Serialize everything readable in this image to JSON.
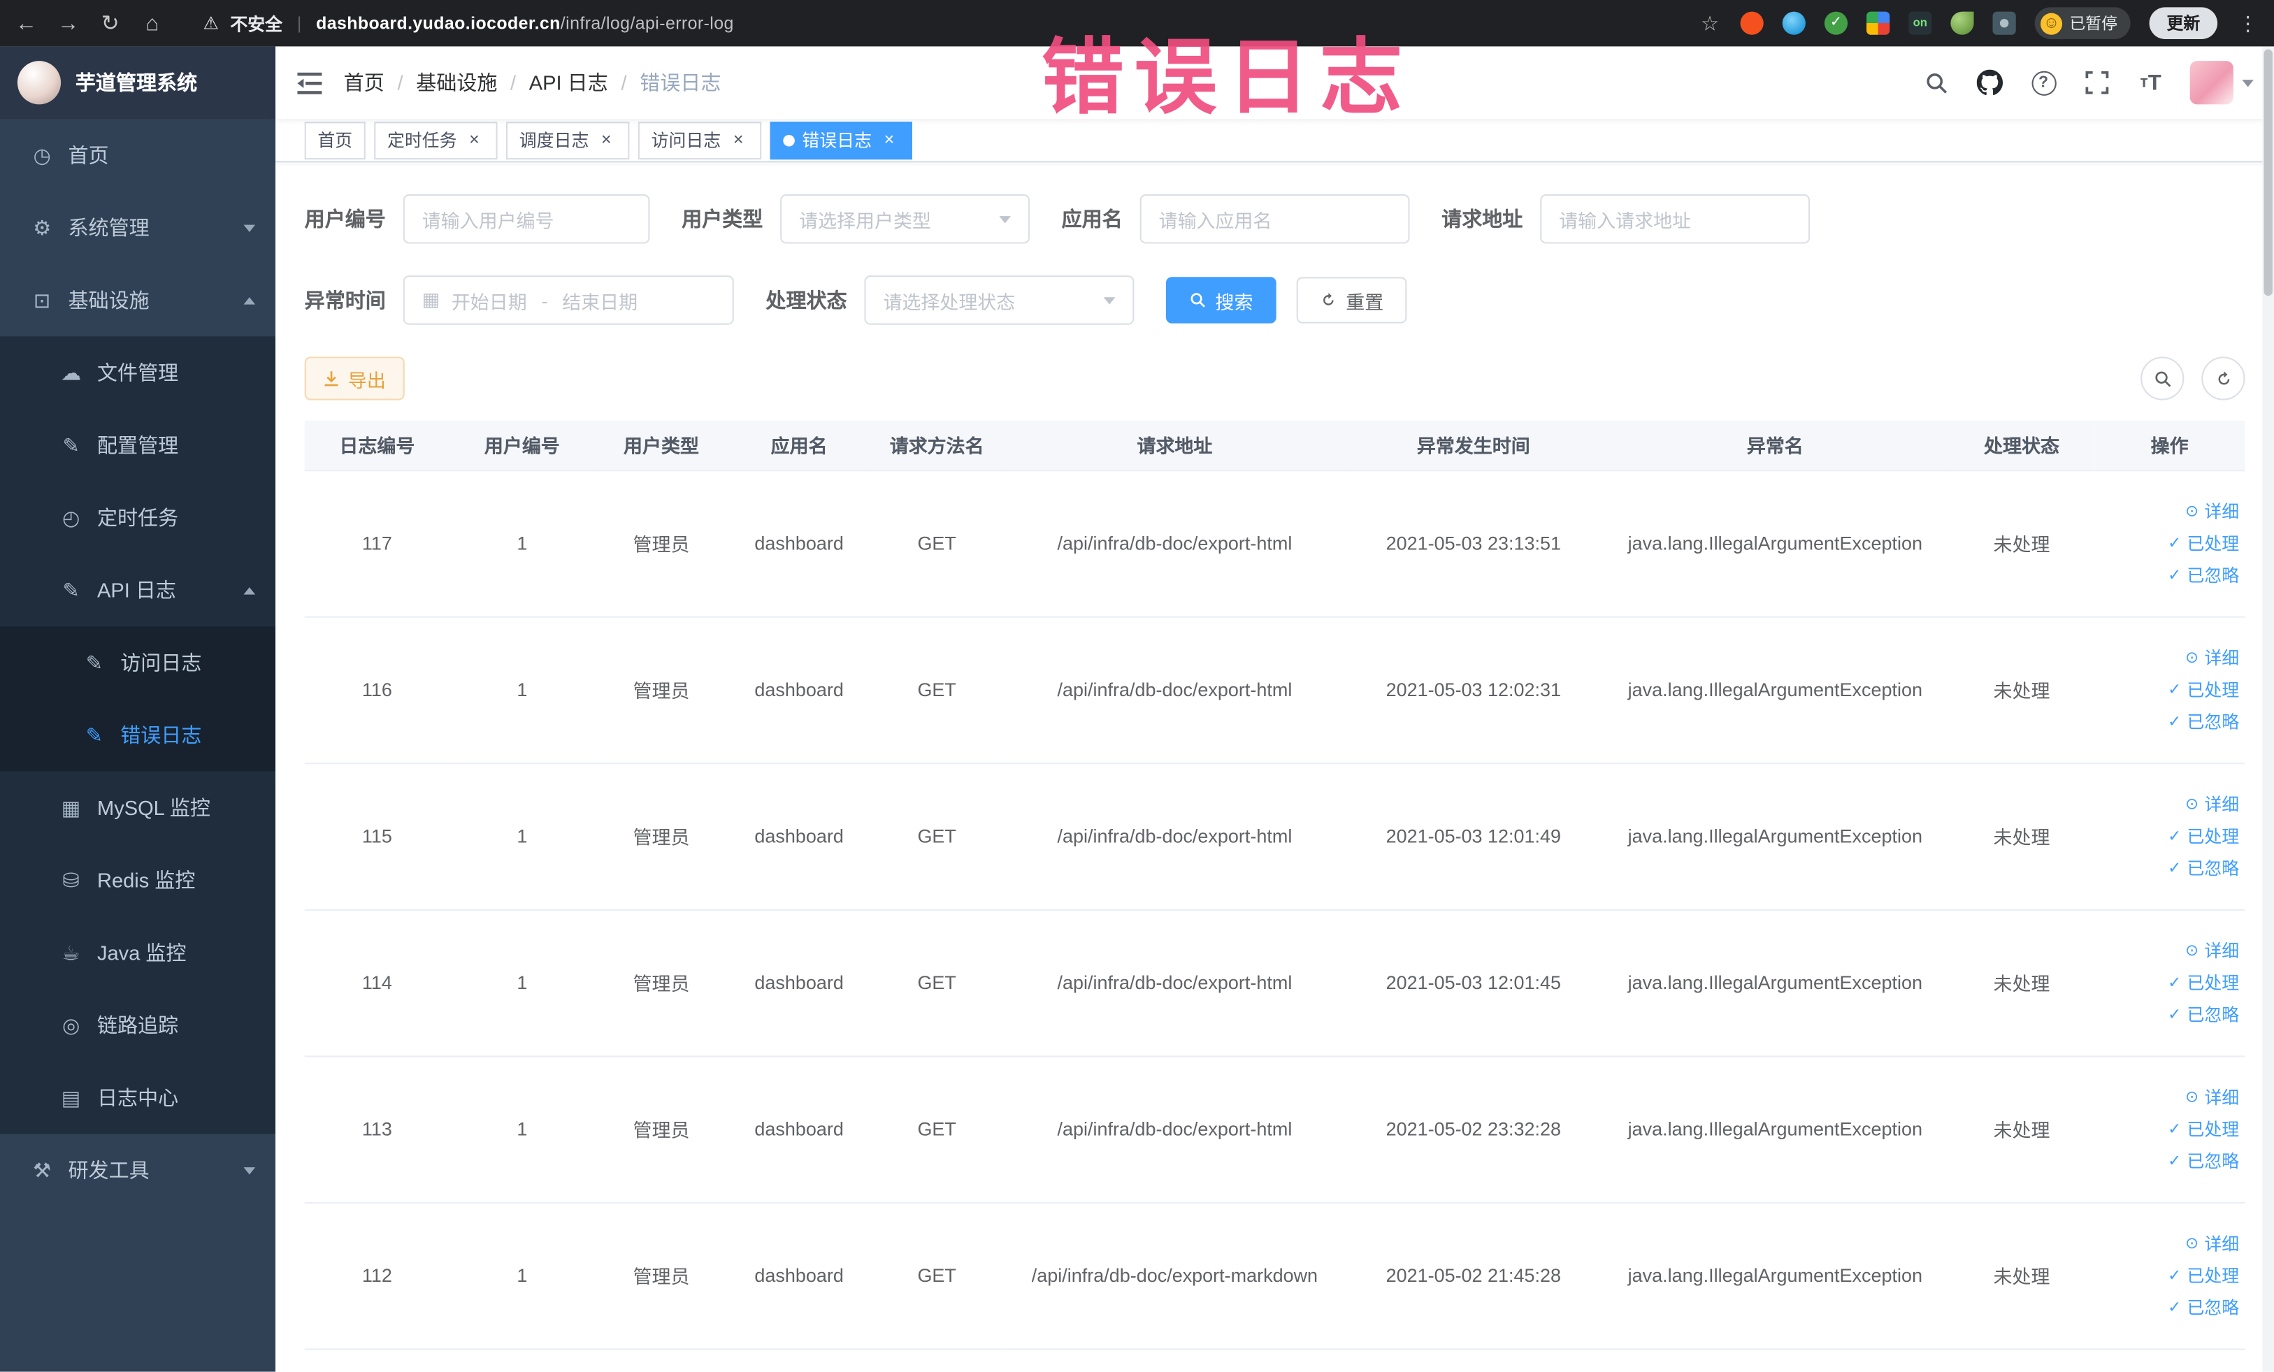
{
  "colors": {
    "accent": "#409eff",
    "sidebar_bg": "#304156",
    "sidebar_sub_bg": "#1f2d3d",
    "active_tab_bg": "#409eff",
    "warning_button_text": "#e6a23c",
    "annotation_color": "#f04d80"
  },
  "annotation": {
    "text": "错误日志"
  },
  "browser": {
    "security_label": "不安全",
    "url_domain": "dashboard.yudao.iocoder.cn",
    "url_path": "/infra/log/api-error-log",
    "paused_badge": "已暂停",
    "update_button": "更新"
  },
  "sidebar": {
    "title": "芋道管理系统",
    "items": [
      {
        "id": "home",
        "label": "首页",
        "icon": "dashboard-icon",
        "glyph": "◷",
        "level": 0
      },
      {
        "id": "system",
        "label": "系统管理",
        "icon": "gear-icon",
        "glyph": "⚙",
        "level": 0,
        "chevron": "down"
      },
      {
        "id": "infrastructure",
        "label": "基础设施",
        "icon": "monitor-icon",
        "glyph": "⊡",
        "level": 0,
        "chevron": "up"
      },
      {
        "id": "file",
        "label": "文件管理",
        "icon": "cloud-icon",
        "glyph": "☁",
        "level": 1
      },
      {
        "id": "config",
        "label": "配置管理",
        "icon": "edit-icon",
        "glyph": "✎",
        "level": 1
      },
      {
        "id": "job",
        "label": "定时任务",
        "icon": "clock-icon",
        "glyph": "◴",
        "level": 1
      },
      {
        "id": "api-log",
        "label": "API 日志",
        "icon": "log-icon",
        "glyph": "✎",
        "level": 1,
        "chevron": "up"
      },
      {
        "id": "access-log",
        "label": "访问日志",
        "icon": "edit-square-icon",
        "glyph": "✎",
        "level": 2
      },
      {
        "id": "error-log",
        "label": "错误日志",
        "icon": "edit-square-icon",
        "glyph": "✎",
        "level": 2,
        "active": true
      },
      {
        "id": "mysql",
        "label": "MySQL 监控",
        "icon": "grid-icon",
        "glyph": "▦",
        "level": 1
      },
      {
        "id": "redis",
        "label": "Redis 监控",
        "icon": "database-icon",
        "glyph": "⛁",
        "level": 1
      },
      {
        "id": "java",
        "label": "Java 监控",
        "icon": "coffee-icon",
        "glyph": "☕",
        "level": 1
      },
      {
        "id": "trace",
        "label": "链路追踪",
        "icon": "eye-icon",
        "glyph": "◎",
        "level": 1
      },
      {
        "id": "log-center",
        "label": "日志中心",
        "icon": "document-icon",
        "glyph": "▤",
        "level": 1
      },
      {
        "id": "dev-tools",
        "label": "研发工具",
        "icon": "toolbox-icon",
        "glyph": "⚒",
        "level": 0,
        "chevron": "down"
      }
    ]
  },
  "breadcrumb": [
    "首页",
    "基础设施",
    "API 日志",
    "错误日志"
  ],
  "tabs": [
    {
      "id": "home",
      "label": "首页",
      "closable": false,
      "active": false
    },
    {
      "id": "job",
      "label": "定时任务",
      "closable": true,
      "active": false
    },
    {
      "id": "job-log",
      "label": "调度日志",
      "closable": true,
      "active": false
    },
    {
      "id": "access-log",
      "label": "访问日志",
      "closable": true,
      "active": false
    },
    {
      "id": "error-log",
      "label": "错误日志",
      "closable": true,
      "active": true
    }
  ],
  "filters": {
    "user_id_label": "用户编号",
    "user_id_placeholder": "请输入用户编号",
    "user_type_label": "用户类型",
    "user_type_placeholder": "请选择用户类型",
    "app_name_label": "应用名",
    "app_name_placeholder": "请输入应用名",
    "request_url_label": "请求地址",
    "request_url_placeholder": "请输入请求地址",
    "exception_time_label": "异常时间",
    "start_date_placeholder": "开始日期",
    "range_separator": "-",
    "end_date_placeholder": "结束日期",
    "process_status_label": "处理状态",
    "process_status_placeholder": "请选择处理状态",
    "search_button": "搜索",
    "reset_button": "重置"
  },
  "toolbar": {
    "export_label": "导出"
  },
  "table": {
    "headers": [
      "日志编号",
      "用户编号",
      "用户类型",
      "应用名",
      "请求方法名",
      "请求地址",
      "异常发生时间",
      "异常名",
      "处理状态",
      "操作"
    ],
    "actions": [
      {
        "id": "detail",
        "label": "详细",
        "icon": "eye-icon",
        "glyph": "⊙"
      },
      {
        "id": "processed",
        "label": "已处理",
        "icon": "check-icon",
        "glyph": "✓"
      },
      {
        "id": "ignored",
        "label": "已忽略",
        "icon": "check-icon",
        "glyph": "✓"
      }
    ],
    "rows": [
      {
        "id": "117",
        "user_id": "1",
        "user_type": "管理员",
        "app": "dashboard",
        "method": "GET",
        "url": "/api/infra/db-doc/export-html",
        "time": "2021-05-03 23:13:51",
        "exception": "java.lang.IllegalArgumentException",
        "status": "未处理"
      },
      {
        "id": "116",
        "user_id": "1",
        "user_type": "管理员",
        "app": "dashboard",
        "method": "GET",
        "url": "/api/infra/db-doc/export-html",
        "time": "2021-05-03 12:02:31",
        "exception": "java.lang.IllegalArgumentException",
        "status": "未处理"
      },
      {
        "id": "115",
        "user_id": "1",
        "user_type": "管理员",
        "app": "dashboard",
        "method": "GET",
        "url": "/api/infra/db-doc/export-html",
        "time": "2021-05-03 12:01:49",
        "exception": "java.lang.IllegalArgumentException",
        "status": "未处理"
      },
      {
        "id": "114",
        "user_id": "1",
        "user_type": "管理员",
        "app": "dashboard",
        "method": "GET",
        "url": "/api/infra/db-doc/export-html",
        "time": "2021-05-03 12:01:45",
        "exception": "java.lang.IllegalArgumentException",
        "status": "未处理"
      },
      {
        "id": "113",
        "user_id": "1",
        "user_type": "管理员",
        "app": "dashboard",
        "method": "GET",
        "url": "/api/infra/db-doc/export-html",
        "time": "2021-05-02 23:32:28",
        "exception": "java.lang.IllegalArgumentException",
        "status": "未处理"
      },
      {
        "id": "112",
        "user_id": "1",
        "user_type": "管理员",
        "app": "dashboard",
        "method": "GET",
        "url": "/api/infra/db-doc/export-markdown",
        "time": "2021-05-02 21:45:28",
        "exception": "java.lang.IllegalArgumentException",
        "status": "未处理"
      }
    ]
  }
}
